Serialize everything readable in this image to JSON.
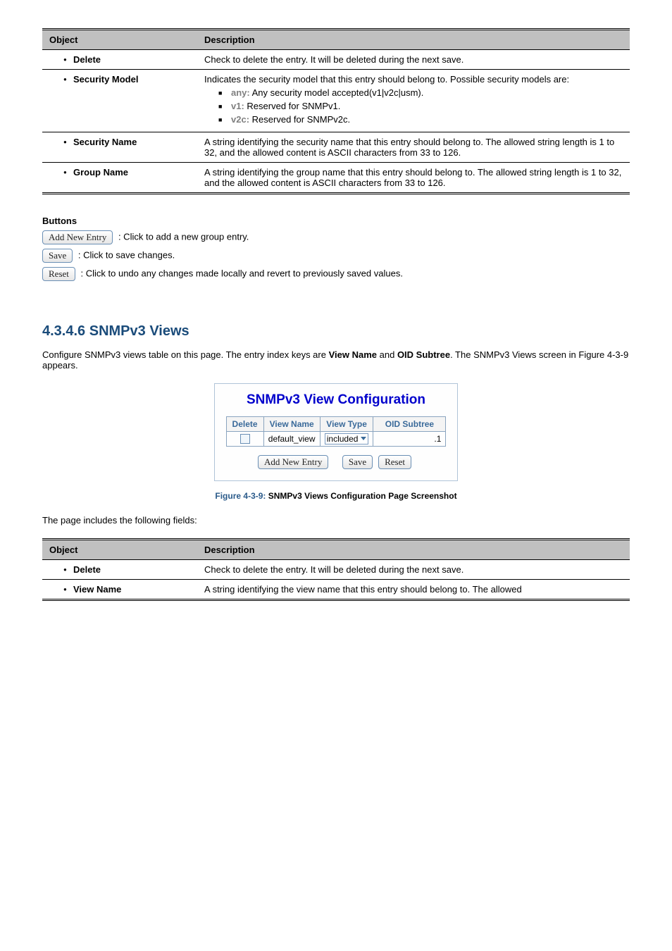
{
  "table1": {
    "headers": [
      "Object",
      "Description"
    ],
    "rows": [
      {
        "obj": "Delete",
        "desc": "Check to delete the entry. It will be deleted during the next save."
      },
      {
        "obj": "Security Model",
        "desc_intro": "Indicates the security model that this entry should belong to. Possible security models are:",
        "items": [
          {
            "label": "any:",
            "text": "Any security model accepted(v1|v2c|usm)."
          },
          {
            "label": "v1:",
            "text": "Reserved for SNMPv1."
          },
          {
            "label": "v2c:",
            "text": "Reserved for SNMPv2c."
          }
        ]
      },
      {
        "obj": "Security Name",
        "desc": "A string identifying the security name that this entry should belong to. The allowed string length is 1 to 32, and the allowed content is ASCII characters from 33 to 126."
      },
      {
        "obj": "Group Name",
        "desc": "A string identifying the group name that this entry should belong to. The allowed string length is 1 to 32, and the allowed content is ASCII characters from 33 to 126."
      }
    ]
  },
  "buttons_heading": "Buttons",
  "btn_add": "Add New Entry",
  "btn_add_desc": ": Click to add a new group entry.",
  "btn_save": "Save",
  "btn_save_desc": ": Click to save changes.",
  "btn_reset": "Reset",
  "btn_reset_desc": ": Click to undo any changes made locally and revert to previously saved values.",
  "section_number": "4.3.4.6",
  "section_title": "SNMPv3 Views",
  "section_desc_pre": "Configure SNMPv3 views table on this page. The entry index keys are ",
  "section_desc_b1": "View Name",
  "section_desc_mid": " and ",
  "section_desc_b2": "OID Subtree",
  "section_desc_post": ". The SNMPv3 Views screen in Figure 4-3-9 appears.",
  "config_box": {
    "title": "SNMPv3 View Configuration",
    "headers": [
      "Delete",
      "View Name",
      "View Type",
      "OID Subtree"
    ],
    "row": {
      "view_name": "default_view",
      "view_type": "included",
      "oid": ".1"
    },
    "buttons": [
      "Add New Entry",
      "Save",
      "Reset"
    ]
  },
  "figure_caption_num": "Figure 4-3-9:",
  "figure_caption_text": " SNMPv3 Views Configuration Page Screenshot",
  "table2_intro": "The page includes the following fields:",
  "table2": {
    "headers": [
      "Object",
      "Description"
    ],
    "rows": [
      {
        "obj": "Delete",
        "desc": "Check to delete the entry. It will be deleted during the next save."
      },
      {
        "obj": "View Name",
        "desc": "A string identifying the view name that this entry should belong to. The allowed"
      }
    ]
  }
}
